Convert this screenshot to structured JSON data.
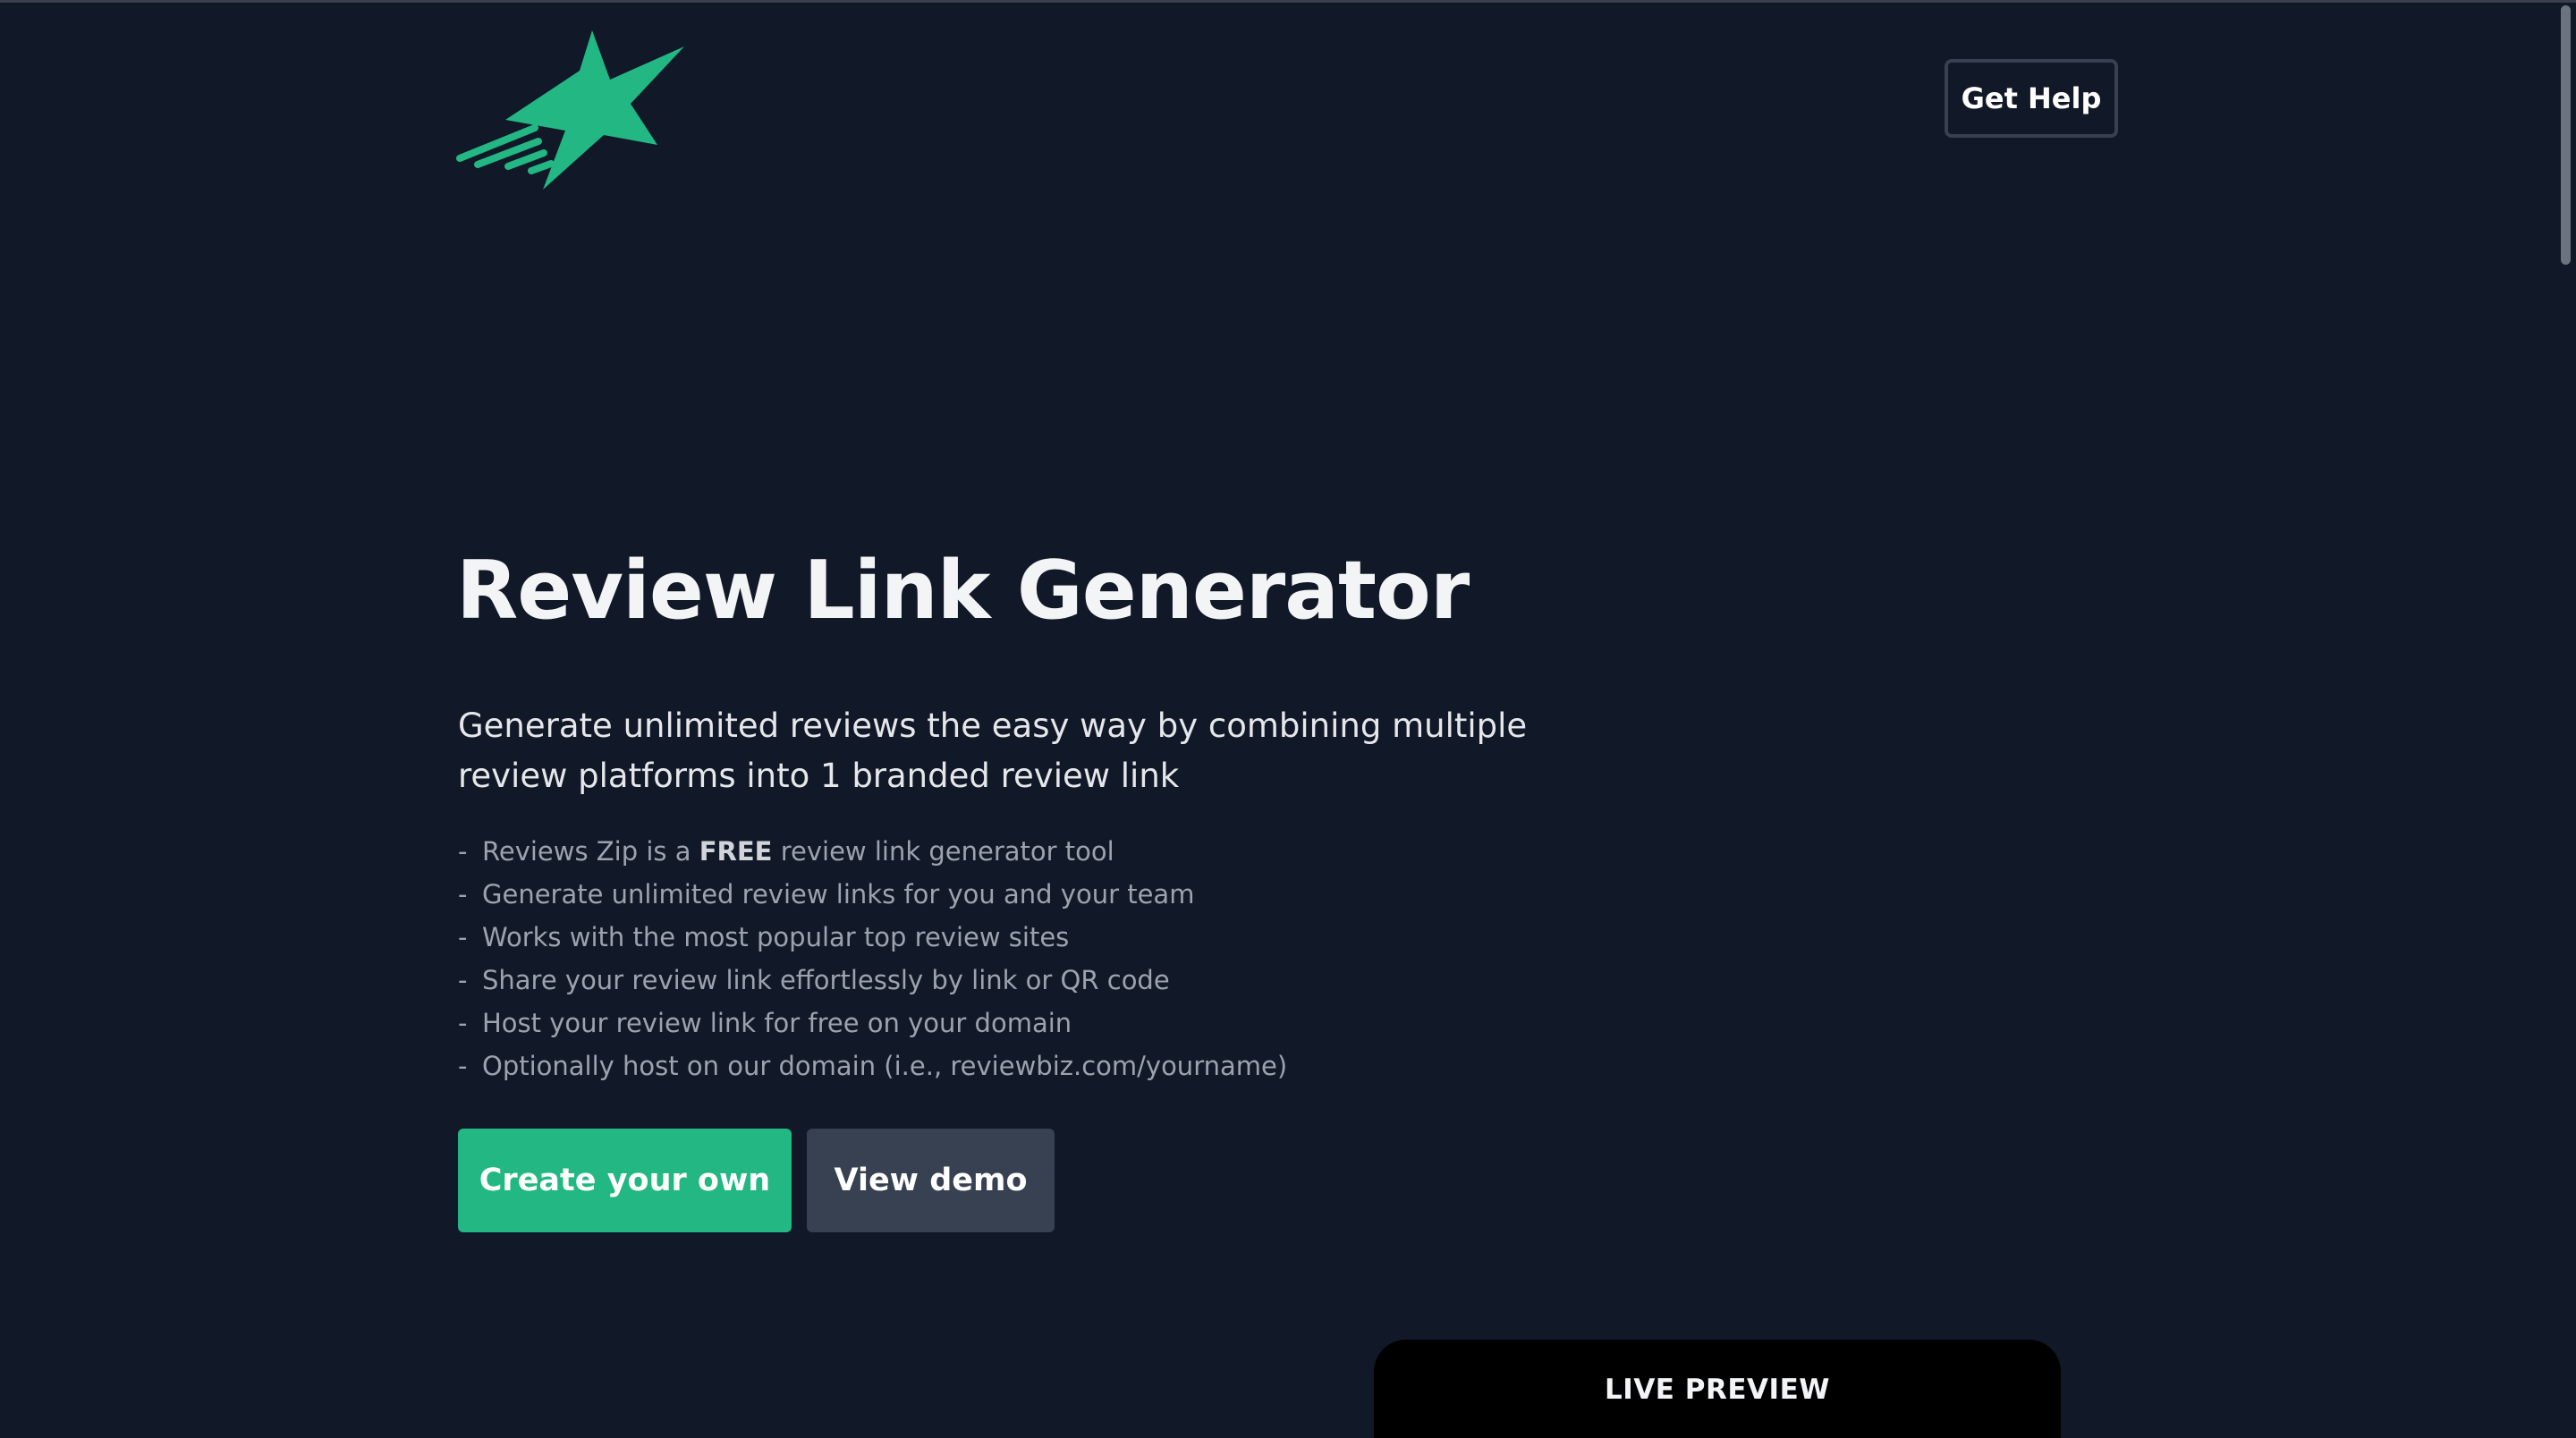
{
  "brand": {
    "accent_color": "#22b783",
    "background_color": "#111827",
    "logo_icon": "shooting-star-icon"
  },
  "header": {
    "help_label": "Get Help"
  },
  "hero": {
    "title": "Review Link Generator",
    "subtitle": "Generate unlimited reviews the easy way by combining multiple review platforms into 1 branded review link"
  },
  "features": {
    "bullet": "-",
    "items": [
      {
        "before": "Reviews Zip is a ",
        "bold": "FREE",
        "after": " review link generator tool"
      },
      {
        "before": "Generate unlimited review links for you and your team",
        "bold": "",
        "after": ""
      },
      {
        "before": "Works with the most popular top review sites",
        "bold": "",
        "after": ""
      },
      {
        "before": "Share your review link effortlessly by link or QR code",
        "bold": "",
        "after": ""
      },
      {
        "before": "Host your review link for free on your domain",
        "bold": "",
        "after": ""
      },
      {
        "before": "Optionally host on our domain (i.e., reviewbiz.com/yourname)",
        "bold": "",
        "after": ""
      }
    ]
  },
  "actions": {
    "create_label": "Create your own",
    "demo_label": "View demo"
  },
  "preview": {
    "label": "LIVE PREVIEW"
  }
}
